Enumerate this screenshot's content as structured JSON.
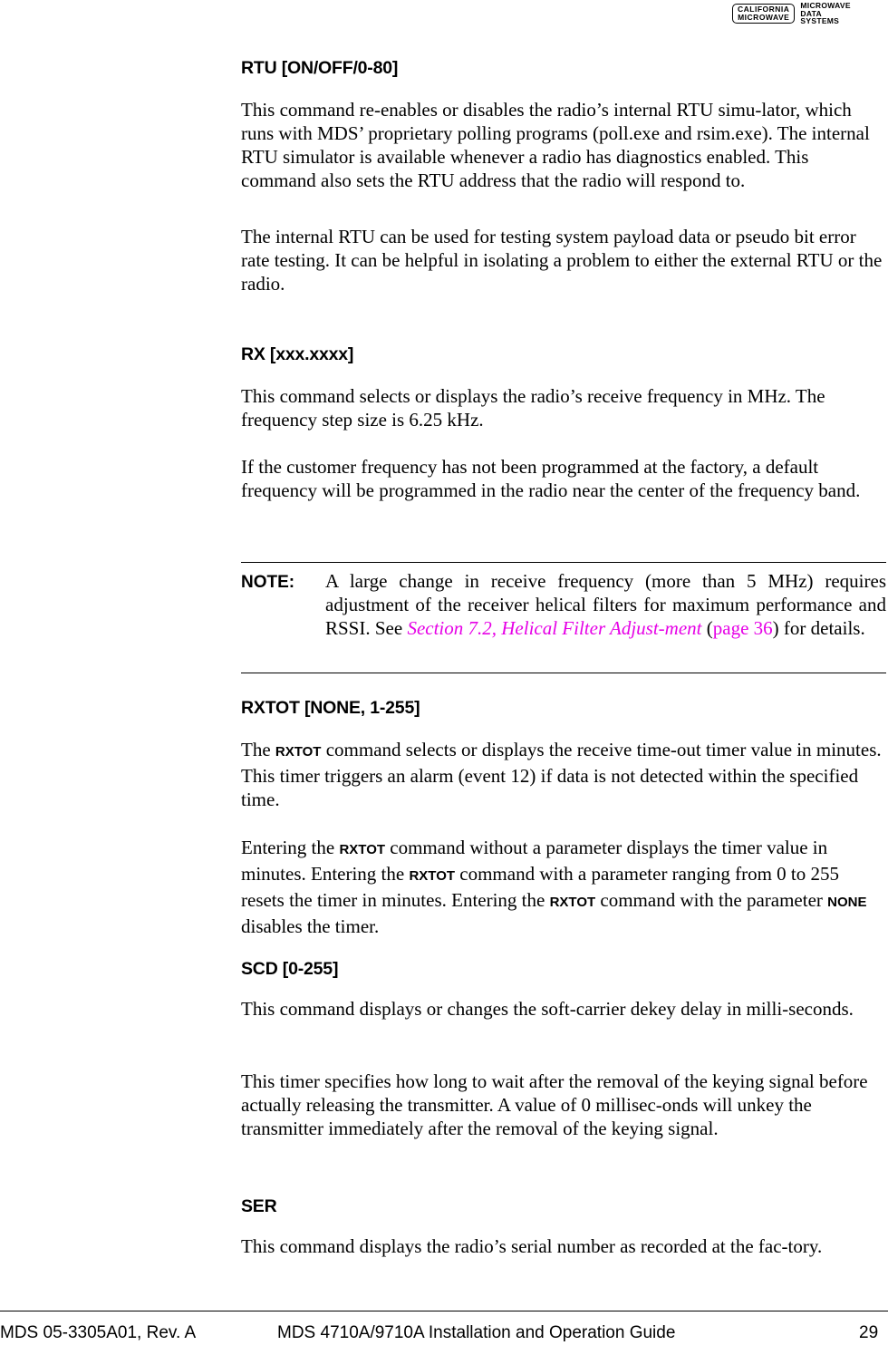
{
  "header": {
    "logo_box_line1": "CALIFORNIA",
    "logo_box_line2": "MICROWAVE",
    "logo_text_line1": "MICROWAVE",
    "logo_text_line2": "DATA",
    "logo_text_line3": "SYSTEMS"
  },
  "sections": {
    "rtu": {
      "heading": "RTU [ON/OFF/0-80]",
      "p1": "This command re-enables or disables the radio’s internal RTU simu-lator, which runs with MDS’ proprietary polling programs (poll.exe and rsim.exe). The internal RTU simulator is available whenever a radio has diagnostics enabled. This command also sets the RTU address that the radio will respond to.",
      "p2": "The internal RTU can be used for testing system payload data or pseudo bit error rate testing. It can be helpful in isolating a problem to either the external RTU or the radio."
    },
    "rx": {
      "heading": "RX [xxx.xxxx]",
      "p1": "This command selects or displays the radio’s receive frequency in MHz. The frequency step size is 6.25 kHz.",
      "p2": "If the customer frequency has not been programmed at the factory, a default frequency will be programmed in the radio near the center of the frequency band.",
      "note": {
        "label": "NOTE:",
        "text_before": "A large change in receive frequency (more than 5 MHz) requires adjustment of the receiver helical filters for maximum performance and RSSI. See ",
        "link_section": "Section 7.2, Helical Filter Adjust-ment",
        "text_mid1": " (",
        "link_page": "page 36",
        "text_after": ") for details.",
        "link_color": "#e600e6"
      }
    },
    "rxtot": {
      "heading": "RXTOT [NONE, 1-255]",
      "p1_a": "The ",
      "p1_cmd": "RXTOT",
      "p1_b": " command selects or displays the receive time-out timer value in minutes. This timer triggers an alarm (event 12) if data is not detected within the specified time.",
      "p2_a": "Entering the ",
      "p2_cmd1": "RXTOT",
      "p2_b": " command without a parameter displays the timer value in minutes. Entering the ",
      "p2_cmd2": "RXTOT",
      "p2_c": " command with a parameter ranging from 0 to 255 resets the timer in minutes. Entering the ",
      "p2_cmd3": "RXTOT",
      "p2_d": " command with the parameter ",
      "p2_param": "NONE",
      "p2_e": " disables the timer."
    },
    "scd": {
      "heading": "SCD [0-255]",
      "p1": "This command displays or changes the soft-carrier dekey delay in milli-seconds.",
      "p2": "This timer specifies how long to wait after the removal of the keying signal before actually releasing the transmitter. A value of 0 millisec-onds will unkey the transmitter immediately after the removal of the keying signal."
    },
    "ser": {
      "heading": "SER",
      "p1": "This command displays the radio’s serial number as recorded at the fac-tory."
    }
  },
  "footer": {
    "doc_number": "MDS 05-3305A01, Rev. A",
    "guide_title": "MDS 4710A/9710A Installation and Operation Guide",
    "page_number": "29"
  }
}
